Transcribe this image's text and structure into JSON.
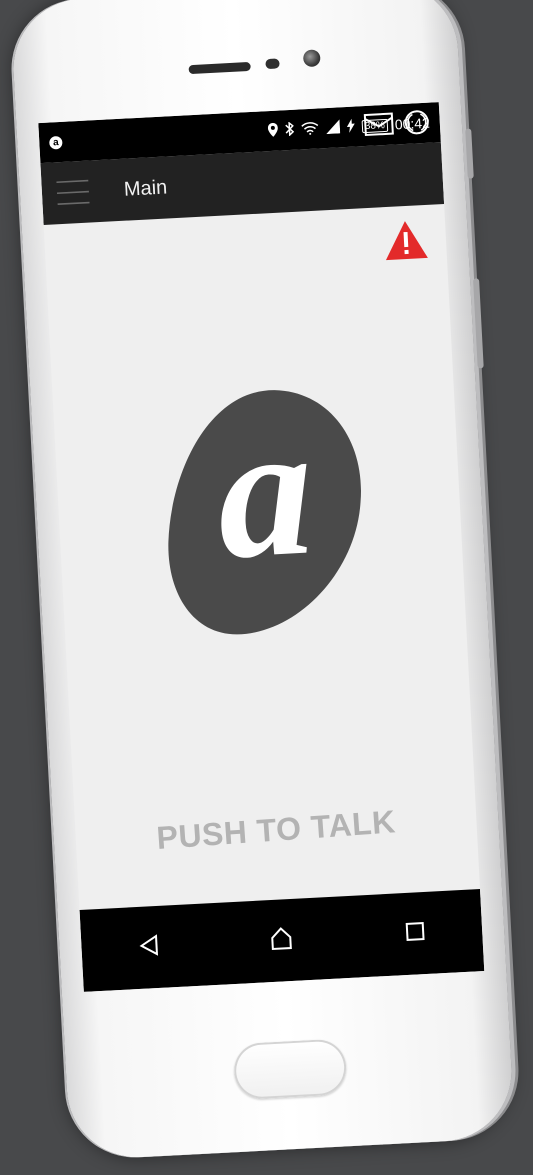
{
  "statusbar": {
    "app_badge": "a",
    "battery": "38%",
    "time": "00:42",
    "icons": [
      "location-icon",
      "bluetooth-icon",
      "wifi-icon",
      "signal-icon",
      "charging-icon"
    ]
  },
  "toolbar": {
    "title": "Main",
    "icons": [
      "menu-icon",
      "mail-icon",
      "status-ring-icon"
    ]
  },
  "main": {
    "alert_icon": "warning-triangle-icon",
    "logo_letter": "a",
    "ptt_label": "PUSH TO TALK"
  },
  "navbar": {
    "icons": [
      "back-icon",
      "home-icon",
      "recents-icon"
    ]
  },
  "colors": {
    "background": "#48494b",
    "toolbar": "#222222",
    "screen": "#efefef",
    "logo": "#4a4a4a",
    "alert": "#e32a2a",
    "ptt_text": "#b3b3b3"
  }
}
